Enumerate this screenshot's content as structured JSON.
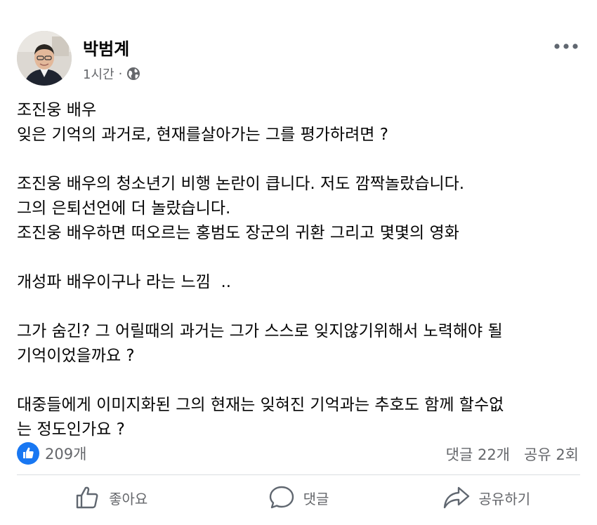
{
  "post": {
    "author": "박범계",
    "time": "1시간",
    "dot": "·",
    "audience_icon": "globe-icon",
    "more_icon": "more-horizontal-icon",
    "lines": [
      "조진웅 배우",
      "잊은 기억의 과거로, 현재를살아가는 그를 평가하려면 ?",
      "",
      "조진웅 배우의 청소년기 비행 논란이 큽니다. 저도 깜짝놀랐습니다.",
      "그의 은퇴선언에 더 놀랐습니다.",
      "조진웅 배우하면 떠오르는 홍범도 장군의 귀환 그리고 몇몇의 영화",
      "",
      "개성파 배우이구나 라는 느낌  ..",
      "",
      "그가 숨긴? 그 어릴때의 과거는 그가 스스로 잊지않기위해서 노력해야 될",
      "기억이었을까요 ?",
      "",
      "대중들에게 이미지화된 그의 현재는 잊혀진 기억과는 추호도 함께 할수없",
      "는 정도인가요 ?"
    ]
  },
  "reactions": {
    "like_count": "209개",
    "comments": "댓글 22개",
    "shares": "공유 2회",
    "like_color": "#1877f2"
  },
  "actions": {
    "like": "좋아요",
    "comment": "댓글",
    "share": "공유하기"
  }
}
